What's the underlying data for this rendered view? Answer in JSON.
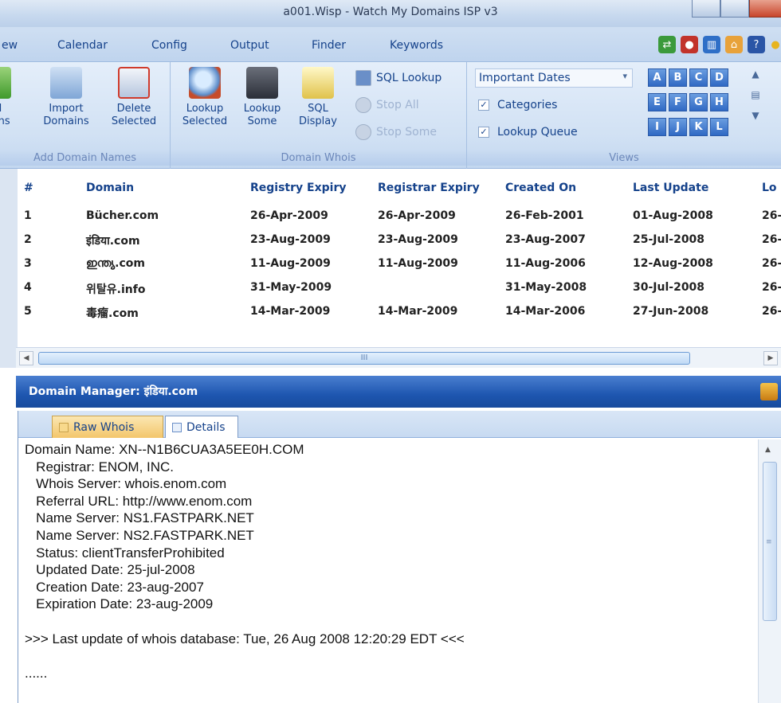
{
  "window": {
    "title": "a001.Wisp - Watch My Domains ISP v3"
  },
  "menu": [
    "ew",
    "Calendar",
    "Config",
    "Output",
    "Finder",
    "Keywords"
  ],
  "toolbar_icons": [
    "arrows-icon",
    "red-bug-icon",
    "book-icon",
    "home-icon",
    "help-icon",
    "bulb-icon"
  ],
  "ribbon": {
    "add_group": {
      "label": "Add Domain Names",
      "add_label": "d\nins",
      "add_label2": "",
      "import_label": "Import\nDomains",
      "delete_label": "Delete\nSelected"
    },
    "whois_group": {
      "label": "Domain Whois",
      "lookup_selected": "Lookup\nSelected",
      "lookup_some": "Lookup\nSome",
      "sql_display": "SQL\nDisplay",
      "sql_lookup": "SQL Lookup",
      "stop_all": "Stop All",
      "stop_some": "Stop Some"
    },
    "views_group": {
      "label": "Views",
      "combo_value": "Important Dates",
      "checks": [
        {
          "label": "Categories",
          "checked": true
        },
        {
          "label": "Lookup Queue",
          "checked": true
        }
      ],
      "letters": [
        "A",
        "B",
        "C",
        "D",
        "E",
        "F",
        "G",
        "H",
        "I",
        "J",
        "K",
        "L"
      ]
    }
  },
  "grid": {
    "columns": [
      "#",
      "Domain",
      "Registry Expiry",
      "Registrar Expiry",
      "Created On",
      "Last Update",
      "Lo"
    ],
    "rows": [
      [
        "1",
        "Bücher.com",
        "26-Apr-2009",
        "26-Apr-2009",
        "26-Feb-2001",
        "01-Aug-2008",
        "26-"
      ],
      [
        "2",
        "इंडिया.com",
        "23-Aug-2009",
        "23-Aug-2009",
        "23-Aug-2007",
        "25-Jul-2008",
        "26-"
      ],
      [
        "3",
        "ഇന്ത്യ.com",
        "11-Aug-2009",
        "11-Aug-2009",
        "11-Aug-2006",
        "12-Aug-2008",
        "26-"
      ],
      [
        "4",
        "위탈유.info",
        "31-May-2009",
        "",
        "31-May-2008",
        "30-Jul-2008",
        "26-"
      ],
      [
        "5",
        "毒瘤.com",
        "14-Mar-2009",
        "14-Mar-2009",
        "14-Mar-2006",
        "27-Jun-2008",
        "26-"
      ]
    ],
    "hscroll_mark": "III"
  },
  "domain_manager": {
    "title": "Domain Manager: इंडिया.com",
    "tabs": [
      "Raw Whois",
      "Details"
    ],
    "whois_text": "Domain Name: XN--N1B6CUA3A5EE0H.COM\n   Registrar: ENOM, INC.\n   Whois Server: whois.enom.com\n   Referral URL: http://www.enom.com\n   Name Server: NS1.FASTPARK.NET\n   Name Server: NS2.FASTPARK.NET\n   Status: clientTransferProhibited\n   Updated Date: 25-jul-2008\n   Creation Date: 23-aug-2007\n   Expiration Date: 23-aug-2009\n\n>>> Last update of whois database: Tue, 26 Aug 2008 12:20:29 EDT <<<\n\n......"
  }
}
